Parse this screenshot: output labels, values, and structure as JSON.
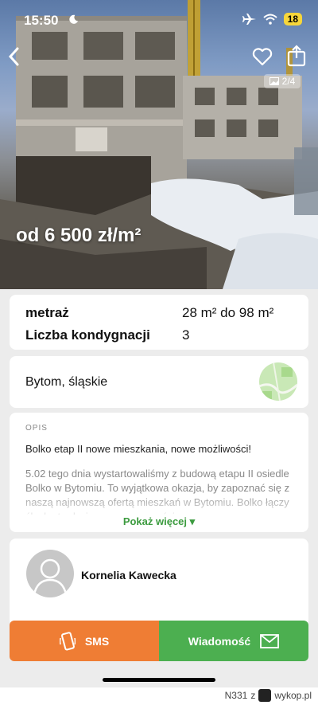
{
  "status_bar": {
    "time": "15:50",
    "battery": "18"
  },
  "hero": {
    "photo_counter": "2/4",
    "price": "od 6 500 zł/m²"
  },
  "specs": [
    {
      "label": "metraż",
      "value": "28 m² do 98 m²"
    },
    {
      "label": "Liczba kondygnacji",
      "value": "3"
    }
  ],
  "location": {
    "text": "Bytom, śląskie"
  },
  "description": {
    "label": "OPIS",
    "title": "Bolko etap II nowe mieszkania, nowe możliwości!",
    "body": "5.02 tego dnia wystartowaliśmy z budową etapu II osiedle Bolko w Bytomiu. To wyjątkowa okazja, by zapoznać się z naszą najnowszą ofertą mieszkań w Bytomiu. Bolko łączy śląską tradycję z nowoczesnością",
    "show_more": "Pokaż więcej"
  },
  "agent": {
    "name": "Kornelia Kawecka"
  },
  "actions": {
    "sms": "SMS",
    "message": "Wiadomość"
  },
  "watermark": {
    "user": "N331",
    "z": "z",
    "site": "wykop.pl"
  },
  "colors": {
    "orange": "#ef7d34",
    "green": "#4caf50",
    "accent_green": "#3c9b3f"
  }
}
